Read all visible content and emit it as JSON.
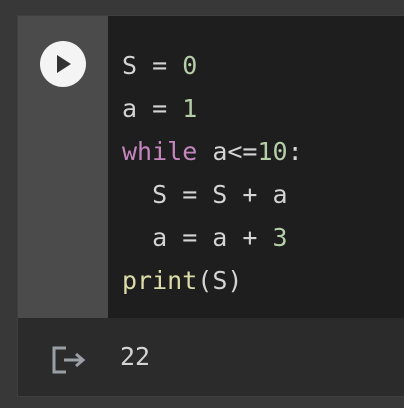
{
  "cell": {
    "code_lines": [
      {
        "tokens": [
          {
            "t": "S = ",
            "c": "plain"
          },
          {
            "t": "0",
            "c": "num"
          }
        ]
      },
      {
        "tokens": [
          {
            "t": "a = ",
            "c": "plain"
          },
          {
            "t": "1",
            "c": "num"
          }
        ]
      },
      {
        "tokens": [
          {
            "t": "while",
            "c": "kw"
          },
          {
            "t": " a<=",
            "c": "plain"
          },
          {
            "t": "10",
            "c": "num"
          },
          {
            "t": ":",
            "c": "plain"
          }
        ]
      },
      {
        "tokens": [
          {
            "t": "  S = S + a",
            "c": "plain"
          }
        ]
      },
      {
        "tokens": [
          {
            "t": "  a = a + ",
            "c": "plain"
          },
          {
            "t": "3",
            "c": "num"
          }
        ]
      },
      {
        "tokens": [
          {
            "t": "print",
            "c": "fn"
          },
          {
            "t": "(S)",
            "c": "plain"
          }
        ]
      }
    ],
    "output": "22",
    "icons": {
      "run": "play-icon",
      "output": "output-redirect-icon"
    }
  },
  "colors": {
    "keyword": "#c586c0",
    "number": "#b5cea8",
    "function": "#dcdcaa",
    "text": "#d4d4d4"
  }
}
